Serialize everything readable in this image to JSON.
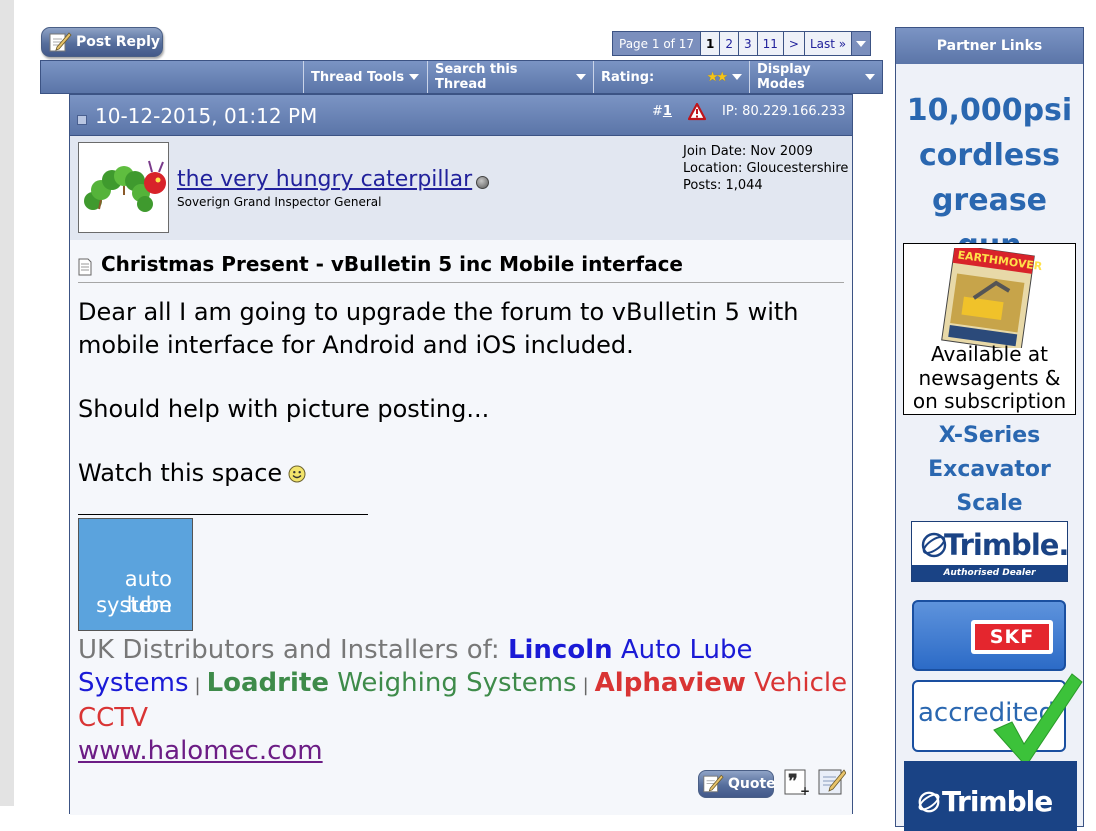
{
  "toolbar": {
    "post_reply_label": "Post Reply",
    "pagination": {
      "label": "Page 1 of 17",
      "current": "1",
      "pages": [
        "2",
        "3",
        "11"
      ],
      "next": ">",
      "last": "Last »"
    },
    "thread_tools_label": "Thread Tools",
    "search_thread_label": "Search this Thread",
    "rating_label": "Rating:",
    "rating_stars": 2,
    "rating_glyph": "★★",
    "display_modes_label": "Display Modes"
  },
  "post": {
    "date": "10-12-2015, 01:12 PM",
    "number_prefix": "#",
    "number": "1",
    "ip": "IP: 80.229.166.233",
    "author": {
      "name": "the very hungry caterpillar",
      "title": "Soverign Grand Inspector General",
      "join_date": "Join Date: Nov 2009",
      "location": "Location: Gloucestershire",
      "posts": "Posts: 1,044",
      "status": "offline"
    },
    "title": "Christmas Present - vBulletin 5 inc Mobile interface",
    "message": [
      "Dear all I am going to upgrade the forum to vBulletin 5 with mobile interface for Android and iOS included.",
      "Should help with picture posting...",
      "Watch this space"
    ],
    "signature": {
      "logo_line1": "auto lube",
      "logo_line2": "system",
      "intro": "UK Distributors and Installers of: ",
      "brand1": "Lincoln",
      "brand1_rest": " Auto Lube Systems",
      "brand2": "Loadrite",
      "brand2_rest": " Weighing Systems",
      "brand3": "Alphaview",
      "brand3_rest": " Vehicle CCTV",
      "separator": "|",
      "link": "www.halomec.com"
    },
    "quote_label": "Quote"
  },
  "sidebar": {
    "title": "Partner Links",
    "ad1_lines": [
      "10,000psi",
      "cordless",
      "grease gun"
    ],
    "ad2_lines": [
      "Available at",
      "newsagents &",
      "on subscription"
    ],
    "ad3_lines": [
      "X-Series",
      "Excavator",
      "Scale"
    ],
    "trimble_word": "Trimble.",
    "trimble_band": "Authorised Dealer",
    "skf_word": "SKF",
    "accredited_word": "accredited",
    "trimble2_word": "Trimble"
  },
  "colors": {
    "header_blue": "#5b75a8",
    "link_blue": "#22229c",
    "lincoln_blue": "#1a1ad6",
    "loadrite_green": "#3e8b4a",
    "alphaview_red": "#d93434",
    "ad_blue": "#2a67b0"
  }
}
